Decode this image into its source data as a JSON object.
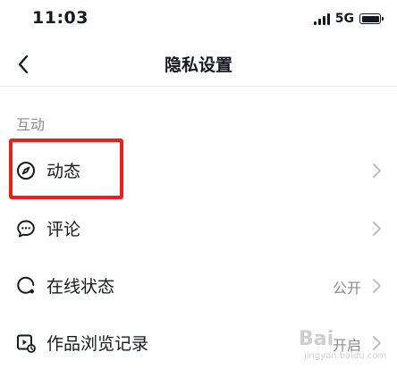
{
  "status_bar": {
    "time": "11:03",
    "network": "5G",
    "icons": [
      "signal-icon",
      "battery-icon"
    ]
  },
  "nav": {
    "title": "隐私设置",
    "back_icon": "chevron-left-icon"
  },
  "sections": [
    {
      "header": "互动",
      "items": [
        {
          "label": "动态",
          "icon": "compass-icon",
          "value": "",
          "highlighted": true
        },
        {
          "label": "评论",
          "icon": "chat-bubble-icon",
          "value": ""
        },
        {
          "label": "在线状态",
          "icon": "online-status-icon",
          "value": "公开"
        },
        {
          "label": "作品浏览记录",
          "icon": "video-history-icon",
          "value": "开启"
        }
      ]
    }
  ],
  "watermark": {
    "main": "Bai",
    "sub": "jingyan.baidu.com"
  },
  "colors": {
    "text": "#161823",
    "secondary": "#8a8b91",
    "highlight": "#e8221b",
    "divider": "#ececec"
  }
}
